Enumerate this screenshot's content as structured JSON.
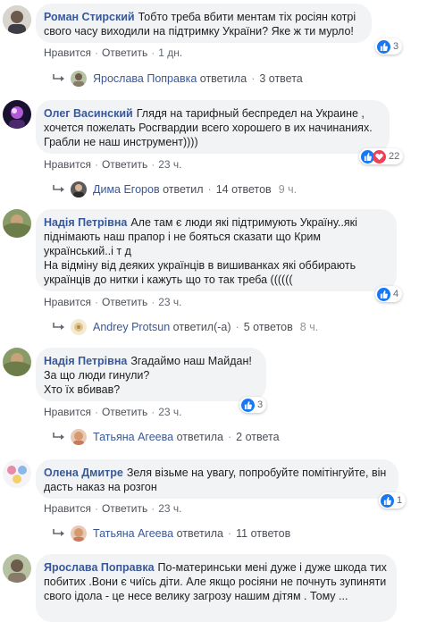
{
  "comments": [
    {
      "author": "Роман Стирский",
      "text": "Тобто треба вбити ментам тіх росіян котрі свого часу виходили на підтримку України? Яке ж ти мурло!",
      "reactions": "3",
      "reaction_types": [
        "like"
      ],
      "actions": {
        "like": "Нравится",
        "reply": "Ответить",
        "time": "1 дн."
      },
      "reply_summary": {
        "name": "Ярослава Поправка",
        "verb": "ответила",
        "count": "3 ответа",
        "time": ""
      }
    },
    {
      "author": "Олег Васинский",
      "text": "Глядя на тарифный беспредел на Украине , хочется пожелать Росгвардии всего хорошего в их начинаниях. Грабли не наш инструмент))))",
      "reactions": "22",
      "reaction_types": [
        "like",
        "love"
      ],
      "actions": {
        "like": "Нравится",
        "reply": "Ответить",
        "time": "23 ч."
      },
      "reply_summary": {
        "name": "Дима Егоров",
        "verb": "ответил",
        "count": "14 ответов",
        "time": "9 ч."
      }
    },
    {
      "author": "Надія Петрівна",
      "text": "Але там є люди які підтримують Україну..які піднімають наш прапор і не бояться сказати що Крим український..і т д\nНа відміну від деяких українців в вишиванках які оббирають українців до нитки і кажуть що то так треба ((((((",
      "reactions": "4",
      "reaction_types": [
        "like"
      ],
      "actions": {
        "like": "Нравится",
        "reply": "Ответить",
        "time": "23 ч."
      },
      "reply_summary": {
        "name": "Andrey Protsun",
        "verb": "ответил(-а)",
        "count": "5 ответов",
        "time": "8 ч."
      }
    },
    {
      "author": "Надія Петрівна",
      "text": "Згадаймо наш Майдан!\nЗа що люди гинули?\nХто їх вбивав?",
      "reactions": "3",
      "reaction_types": [
        "like"
      ],
      "actions": {
        "like": "Нравится",
        "reply": "Ответить",
        "time": "23 ч."
      },
      "reply_summary": {
        "name": "Татьяна Агеева",
        "verb": "ответила",
        "count": "2 ответа",
        "time": ""
      }
    },
    {
      "author": "Олена Дмитре",
      "text": "Зеля візьме на увагу, попробуйте помітінгуйте, він дасть наказ на розгон",
      "reactions": "1",
      "reaction_types": [
        "like"
      ],
      "actions": {
        "like": "Нравится",
        "reply": "Ответить",
        "time": "23 ч."
      },
      "reply_summary": {
        "name": "Татьяна Агеева",
        "verb": "ответила",
        "count": "11 ответов",
        "time": ""
      }
    },
    {
      "author": "Ярослава Поправка",
      "text": "По-материнськи мені дуже і дуже шкода тих побитих .Вони є чиїсь діти. Але якщо росіяни не почнуть зупиняти свого ідола - це несе велику загрозу нашим дітям . Тому ...",
      "reactions": "",
      "reaction_types": [],
      "actions": {
        "like": "",
        "reply": "",
        "time": ""
      },
      "reply_summary": null
    }
  ],
  "colors": {
    "link": "#385898",
    "bubble": "#f2f3f5",
    "like": "#1877f2",
    "love": "#f33e58",
    "meta": "#606770"
  }
}
